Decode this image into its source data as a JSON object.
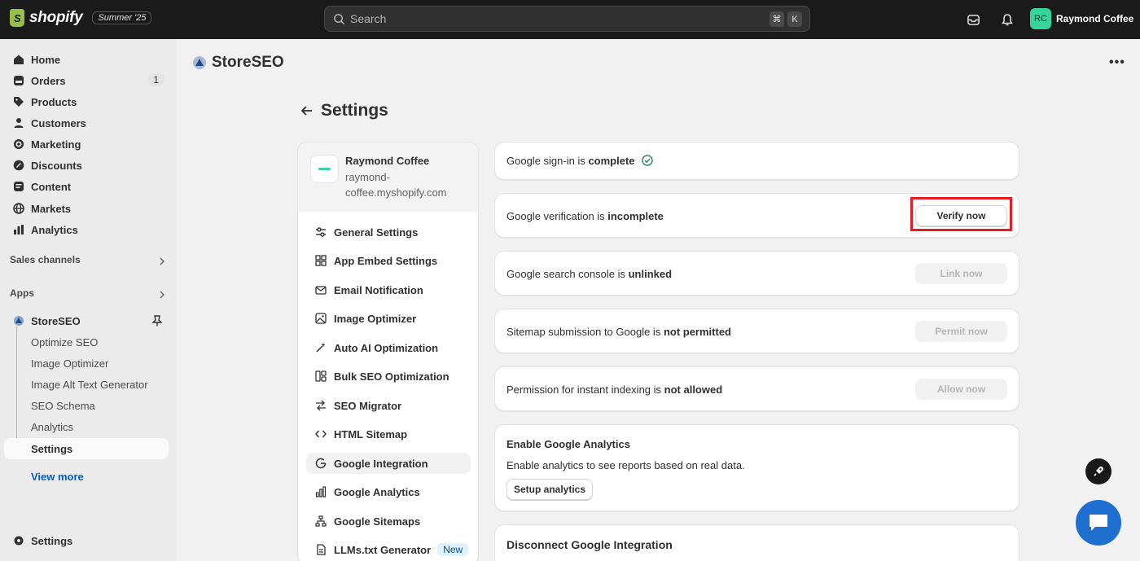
{
  "topbar": {
    "logo_text": "shopify",
    "edition_badge": "Summer '25",
    "search_placeholder": "Search",
    "shortcut_keys": [
      "⌘",
      "K"
    ],
    "user_initials": "RC",
    "user_name": "Raymond Coffee",
    "avatar_color": "#36d39a"
  },
  "sidebar": {
    "items": [
      {
        "label": "Home",
        "icon": "home-icon"
      },
      {
        "label": "Orders",
        "icon": "orders-icon",
        "count": "1"
      },
      {
        "label": "Products",
        "icon": "tag-icon"
      },
      {
        "label": "Customers",
        "icon": "person-icon"
      },
      {
        "label": "Marketing",
        "icon": "target-icon"
      },
      {
        "label": "Discounts",
        "icon": "discount-icon"
      },
      {
        "label": "Content",
        "icon": "content-icon"
      },
      {
        "label": "Markets",
        "icon": "globe-icon"
      },
      {
        "label": "Analytics",
        "icon": "bar-chart-icon"
      }
    ],
    "sales_channels": "Sales channels",
    "apps": "Apps",
    "app_name": "StoreSEO",
    "app_subitems": [
      "Optimize SEO",
      "Image Optimizer",
      "Image Alt Text Generator",
      "SEO Schema",
      "Analytics",
      "Settings"
    ],
    "active_subitem": "Settings",
    "view_more": "View more",
    "settings": "Settings"
  },
  "main": {
    "app_title": "StoreSEO",
    "page_title": "Settings",
    "store": {
      "name": "Raymond Coffee",
      "domain": "raymond-coffee.myshopify.com"
    },
    "menu": [
      {
        "label": "General Settings",
        "icon": "sliders-icon"
      },
      {
        "label": "App Embed Settings",
        "icon": "apps-icon"
      },
      {
        "label": "Email Notification",
        "icon": "email-icon"
      },
      {
        "label": "Image Optimizer",
        "icon": "image-icon"
      },
      {
        "label": "Auto AI Optimization",
        "icon": "magic-icon"
      },
      {
        "label": "Bulk SEO Optimization",
        "icon": "bulk-icon"
      },
      {
        "label": "SEO Migrator",
        "icon": "migrate-icon"
      },
      {
        "label": "HTML Sitemap",
        "icon": "code-icon"
      },
      {
        "label": "Google Integration",
        "icon": "google-icon",
        "active": true
      },
      {
        "label": "Google Analytics",
        "icon": "analytics-icon"
      },
      {
        "label": "Google Sitemaps",
        "icon": "sitemap-icon"
      },
      {
        "label": "LLMs.txt Generator",
        "icon": "file-icon",
        "badge": "New"
      }
    ],
    "signin": {
      "prefix": "Google sign-in is ",
      "status": "complete"
    },
    "verification": {
      "prefix": "Google verification is ",
      "status": "incomplete",
      "button": "Verify now"
    },
    "console": {
      "prefix": "Google search console is ",
      "status": "unlinked",
      "button": "Link now"
    },
    "sitemap": {
      "prefix": "Sitemap submission to Google is ",
      "status": "not permitted",
      "button": "Permit now"
    },
    "indexing": {
      "prefix": "Permission for instant indexing is ",
      "status": "not allowed",
      "button": "Allow now"
    },
    "analytics": {
      "title": "Enable Google Analytics",
      "description": "Enable analytics to see reports based on real data.",
      "button": "Setup analytics"
    },
    "disconnect": {
      "title": "Disconnect Google Integration"
    }
  },
  "colors": {
    "highlight": "#e51c23",
    "chat_button": "#1f6fd1"
  }
}
